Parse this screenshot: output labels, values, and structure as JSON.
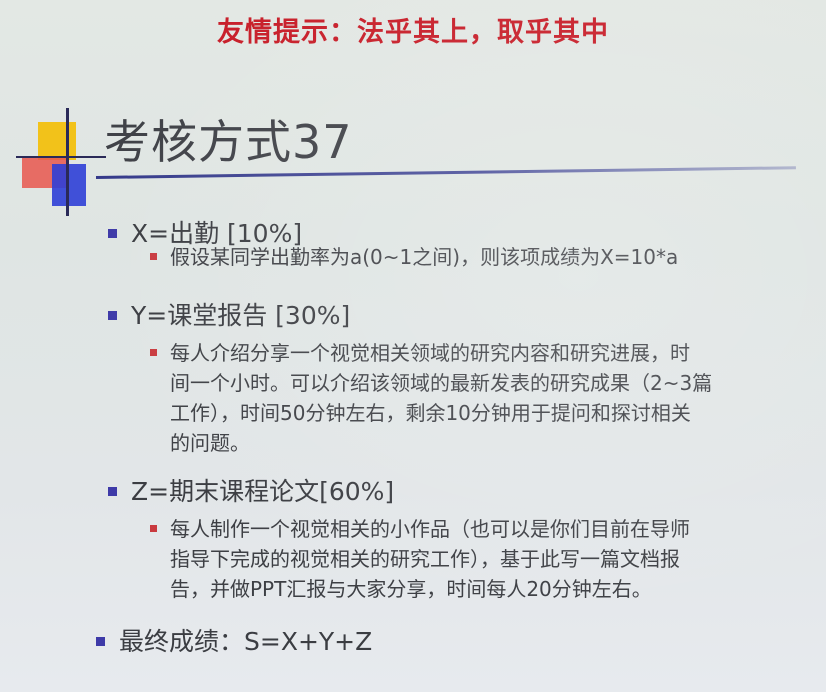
{
  "tip": "友情提示：法乎其上，取乎其中",
  "title": "考核方式37",
  "items": [
    {
      "label": "X=出勤 [10%]",
      "sub": "假设某同学出勤率为a(0~1之间)，则该项成绩为X=10*a"
    },
    {
      "label": "Y=课堂报告 [30%]",
      "sub_lines": [
        "每人介绍分享一个视觉相关领域的研究内容和研究进展，时",
        "间一个小时。可以介绍该领域的最新发表的研究成果（2~3篇",
        "工作），时间50分钟左右，剩余10分钟用于提问和探讨相关",
        "的问题。"
      ]
    },
    {
      "label": "Z=期末课程论文[60%]",
      "sub_lines": [
        "每人制作一个视觉相关的小作品（也可以是你们目前在导师",
        "指导下完成的视觉相关的研究工作），基于此写一篇文档报",
        "告，并做PPT汇报与大家分享，时间每人20分钟左右。"
      ]
    },
    {
      "label": "最终成绩：S=X+Y+Z"
    }
  ],
  "colors": {
    "tip": "#c8202b",
    "title": "#404248",
    "level1_bullet": "#3e3aa8",
    "level2_bullet": "#c93a3f",
    "rule": "#353a8a"
  }
}
